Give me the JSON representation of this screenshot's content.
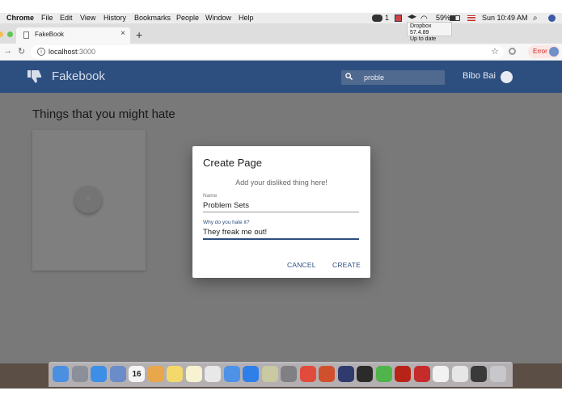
{
  "menubar": {
    "app": "Chrome",
    "items": [
      "File",
      "Edit",
      "View",
      "History",
      "Bookmarks",
      "People",
      "Window",
      "Help"
    ],
    "wechat_badge": "1",
    "battery": "59%",
    "clock": "Sun 10:49 AM"
  },
  "tooltip": {
    "line1": "Dropbox 57.4.89",
    "line2": "Up to date"
  },
  "browser": {
    "tab_title": "FakeBook",
    "tab_close": "×",
    "new_tab": "+",
    "url_host": "localhost",
    "url_port": ":3000",
    "error_label": "Error"
  },
  "header": {
    "brand": "Fakebook",
    "search_value": "proble",
    "user_name": "Bibo Bai"
  },
  "content": {
    "section_title": "Things that you might hate",
    "add_label": "+"
  },
  "dialog": {
    "title": "Create Page",
    "subtitle": "Add your disliked thing here!",
    "name_label": "Name",
    "name_value": "Problem Sets",
    "why_label": "Why do you hate it?",
    "why_value": "They freak me out!",
    "cancel": "CANCEL",
    "create": "CREATE"
  },
  "colors": {
    "primary": "#2d4f80",
    "menubar": "#ececec",
    "error_bg": "#fde7e4",
    "error_text": "#c5221f"
  },
  "dock": {
    "calendar_day": "16",
    "icons": [
      "finder-icon",
      "launchpad-icon",
      "safari-icon",
      "preview-icon",
      "calendar-icon",
      "photos-icon",
      "stickies-icon",
      "notes-icon",
      "textedit-icon",
      "messages-icon",
      "appstore-icon",
      "pencil-icon",
      "system-preferences-icon",
      "chrome-icon",
      "powerpoint-icon",
      "python-icon",
      "terminal-icon",
      "wechat-icon",
      "acrobat-icon",
      "rm-icon",
      "document-icon",
      "screenshot-icon",
      "display-icon",
      "trash-icon"
    ]
  }
}
